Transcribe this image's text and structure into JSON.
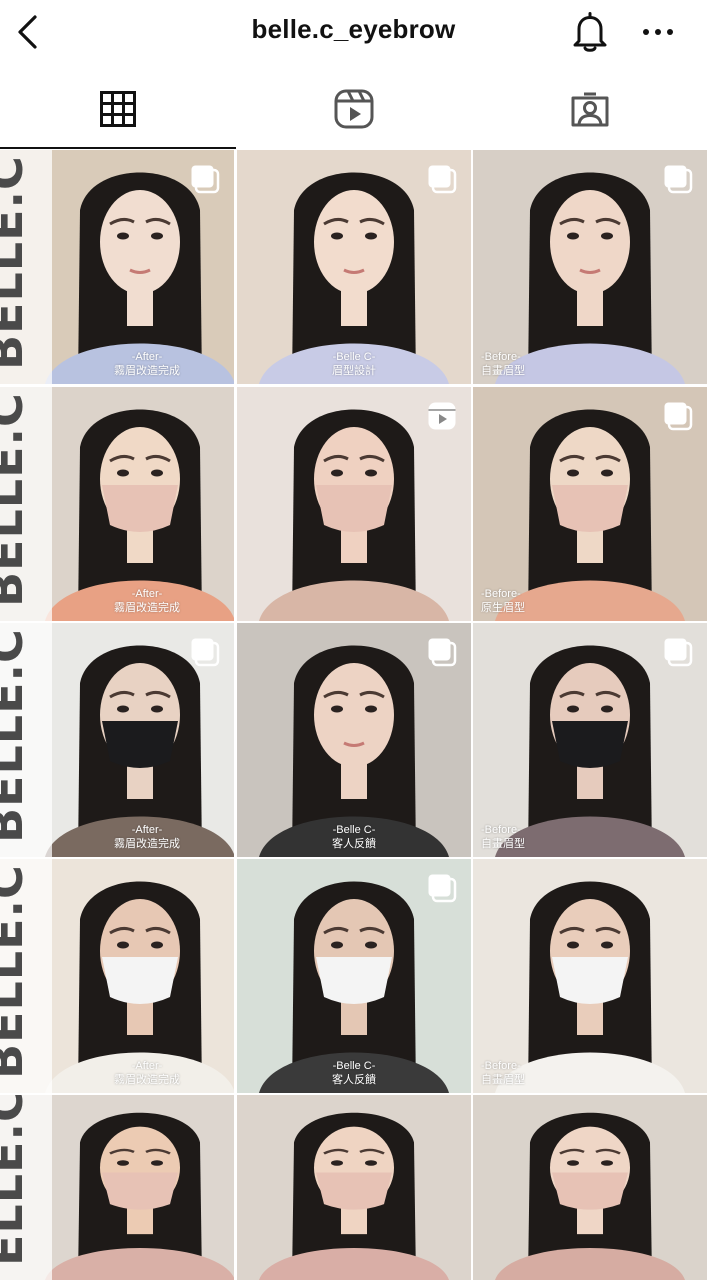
{
  "header": {
    "title": "belle.c_eyebrow",
    "back_icon": "chevron-left-icon",
    "bell_icon": "bell-icon",
    "more_icon": "more-horizontal-icon"
  },
  "tabs": [
    {
      "name": "grid",
      "icon": "grid-icon",
      "active": true
    },
    {
      "name": "reels",
      "icon": "reels-icon",
      "active": false
    },
    {
      "name": "tagged",
      "icon": "tagged-user-icon",
      "active": false
    }
  ],
  "brand": "BELLE.C",
  "brand_partial": "ELLE.C",
  "posts": [
    {
      "caption_top": "-After-",
      "caption_bottom": "霧眉改造完成",
      "badge": "multi",
      "brand": true
    },
    {
      "caption_top": "-Belle C-",
      "caption_bottom": "眉型設計",
      "badge": "multi"
    },
    {
      "caption_top": "-Before-",
      "caption_bottom": "自畫眉型",
      "badge": "multi"
    },
    {
      "caption_top": "-After-",
      "caption_bottom": "霧眉改造完成",
      "badge": "none",
      "brand": true
    },
    {
      "caption_top": "",
      "caption_bottom": "",
      "badge": "reel"
    },
    {
      "caption_top": "-Before-",
      "caption_bottom": "原生眉型",
      "badge": "multi"
    },
    {
      "caption_top": "-After-",
      "caption_bottom": "霧眉改造完成",
      "badge": "multi",
      "brand": true
    },
    {
      "caption_top": "-Belle C-",
      "caption_bottom": "客人反饋",
      "badge": "multi"
    },
    {
      "caption_top": "-Before-",
      "caption_bottom": "自畫眉型",
      "badge": "multi"
    },
    {
      "caption_top": "-After-",
      "caption_bottom": "霧眉改造完成",
      "badge": "none",
      "brand": true
    },
    {
      "caption_top": "-Belle C-",
      "caption_bottom": "客人反饋",
      "badge": "multi"
    },
    {
      "caption_top": "-Before-",
      "caption_bottom": "自畫眉型",
      "badge": "none"
    },
    {
      "caption_top": "",
      "caption_bottom": "",
      "badge": "none",
      "brand_partial": true
    },
    {
      "caption_top": "",
      "caption_bottom": "",
      "badge": "none"
    },
    {
      "caption_top": "",
      "caption_bottom": "",
      "badge": "none"
    }
  ],
  "colors": {
    "accent_text": "#111111",
    "brand_gray": "#4a4a4a"
  }
}
